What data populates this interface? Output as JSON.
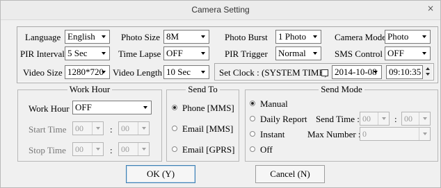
{
  "window": {
    "title": "Camera Setting",
    "close_glyph": "×",
    "close_icon": "close-icon"
  },
  "settings": {
    "language": {
      "label": "Language",
      "value": "English"
    },
    "photo_size": {
      "label": "Photo Size",
      "value": "8M"
    },
    "photo_burst": {
      "label": "Photo Burst",
      "value": "1 Photo"
    },
    "camera_mode": {
      "label": "Camera Mode",
      "value": "Photo"
    },
    "pir_interval": {
      "label": "PIR Interval",
      "value": "5 Sec"
    },
    "time_lapse": {
      "label": "Time Lapse",
      "value": "OFF"
    },
    "pir_trigger": {
      "label": "PIR Trigger",
      "value": "Normal"
    },
    "sms_control": {
      "label": "SMS Control",
      "value": "OFF"
    },
    "video_size": {
      "label": "Video Size",
      "value": "1280*720"
    },
    "video_length": {
      "label": "Video Length",
      "value": "10 Sec"
    },
    "set_clock": {
      "label": "Set Clock : (SYSTEM TIME)",
      "checked": false,
      "date": "2014-10-08",
      "time": "09:10:35"
    }
  },
  "work_hour": {
    "group_title": "Work Hour",
    "work_hour": {
      "label": "Work Hour",
      "value": "OFF"
    },
    "start_time": {
      "label": "Start Time",
      "hour": "00",
      "minute": "00"
    },
    "stop_time": {
      "label": "Stop Time",
      "hour": "00",
      "minute": "00"
    },
    "separator": ":"
  },
  "send_to": {
    "group_title": "Send To",
    "options": [
      {
        "label": "Phone [MMS]",
        "selected": true
      },
      {
        "label": "Email [MMS]",
        "selected": false
      },
      {
        "label": "Email [GPRS]",
        "selected": false
      }
    ]
  },
  "send_mode": {
    "group_title": "Send Mode",
    "options": [
      {
        "label": "Manual",
        "selected": true
      },
      {
        "label": "Daily Report",
        "selected": false
      },
      {
        "label": "Instant",
        "selected": false
      },
      {
        "label": "Off",
        "selected": false
      }
    ],
    "send_time": {
      "label": "Send Time :",
      "hour": "00",
      "minute": "00",
      "separator": ":"
    },
    "max_number": {
      "label": "Max Number :",
      "value": "0"
    }
  },
  "buttons": {
    "ok": "OK (Y)",
    "cancel": "Cancel (N)"
  }
}
